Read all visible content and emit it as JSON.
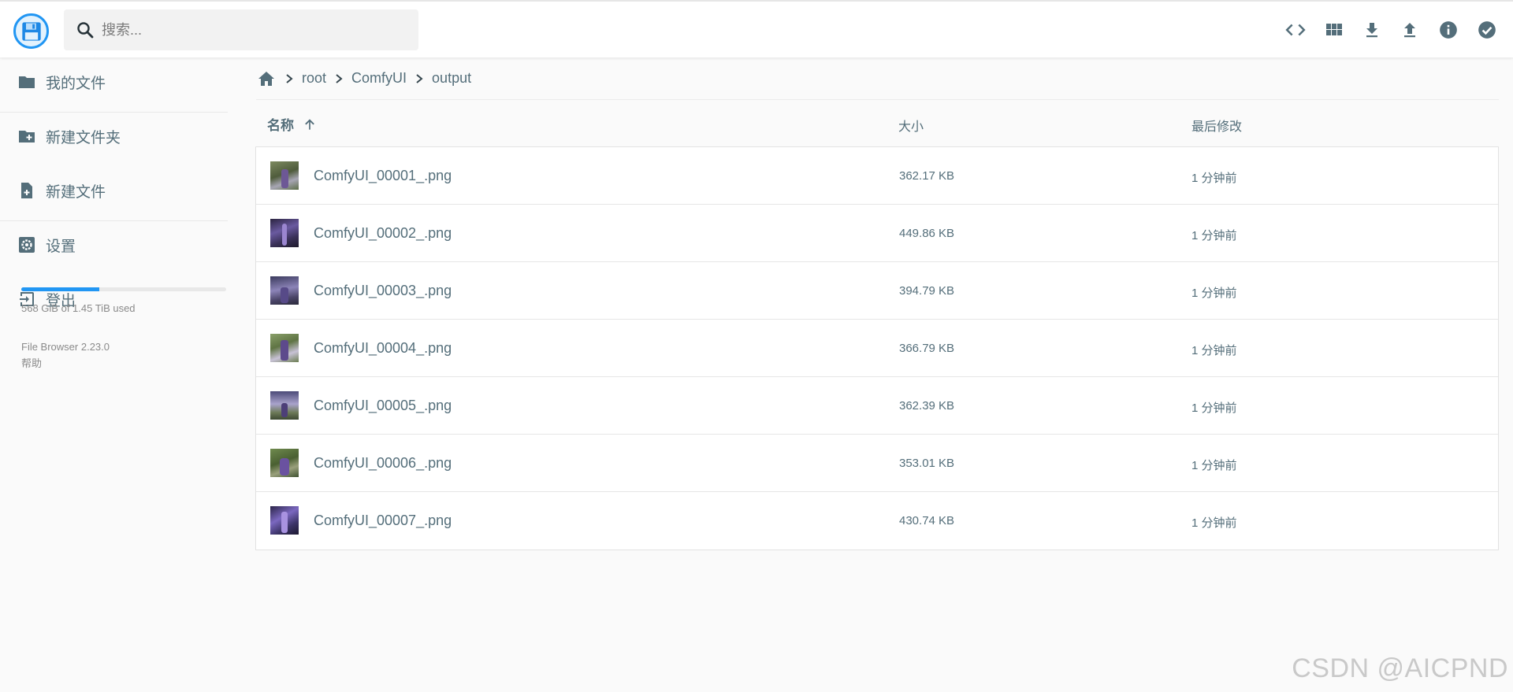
{
  "header": {
    "search_placeholder": "搜索...",
    "buttons": [
      "code-icon",
      "grid-view-icon",
      "download-icon",
      "upload-icon",
      "info-icon",
      "check-circle-icon"
    ]
  },
  "sidebar": {
    "items": [
      {
        "label": "我的文件",
        "icon": "folder-icon"
      },
      {
        "label": "新建文件夹",
        "icon": "create-folder-icon"
      },
      {
        "label": "新建文件",
        "icon": "new-file-icon"
      },
      {
        "label": "设置",
        "icon": "settings-icon"
      },
      {
        "label": "登出",
        "icon": "logout-icon"
      }
    ],
    "usage": {
      "text": "568 GiB of 1.45 TiB used",
      "fraction": 0.38
    },
    "version": "File Browser 2.23.0",
    "help": "帮助"
  },
  "breadcrumb": [
    "root",
    "ComfyUI",
    "output"
  ],
  "table": {
    "headers": {
      "name": "名称",
      "size": "大小",
      "modified": "最后修改"
    },
    "rows": [
      {
        "name": "ComfyUI_00001_.png",
        "size": "362.17 KB",
        "modified": "1 分钟前"
      },
      {
        "name": "ComfyUI_00002_.png",
        "size": "449.86 KB",
        "modified": "1 分钟前"
      },
      {
        "name": "ComfyUI_00003_.png",
        "size": "394.79 KB",
        "modified": "1 分钟前"
      },
      {
        "name": "ComfyUI_00004_.png",
        "size": "366.79 KB",
        "modified": "1 分钟前"
      },
      {
        "name": "ComfyUI_00005_.png",
        "size": "362.39 KB",
        "modified": "1 分钟前"
      },
      {
        "name": "ComfyUI_00006_.png",
        "size": "353.01 KB",
        "modified": "1 分钟前"
      },
      {
        "name": "ComfyUI_00007_.png",
        "size": "430.74 KB",
        "modified": "1 分钟前"
      }
    ]
  },
  "watermark": "CSDN @AICPND",
  "colors": {
    "accent": "#2196f3",
    "text": "#546e7a"
  }
}
